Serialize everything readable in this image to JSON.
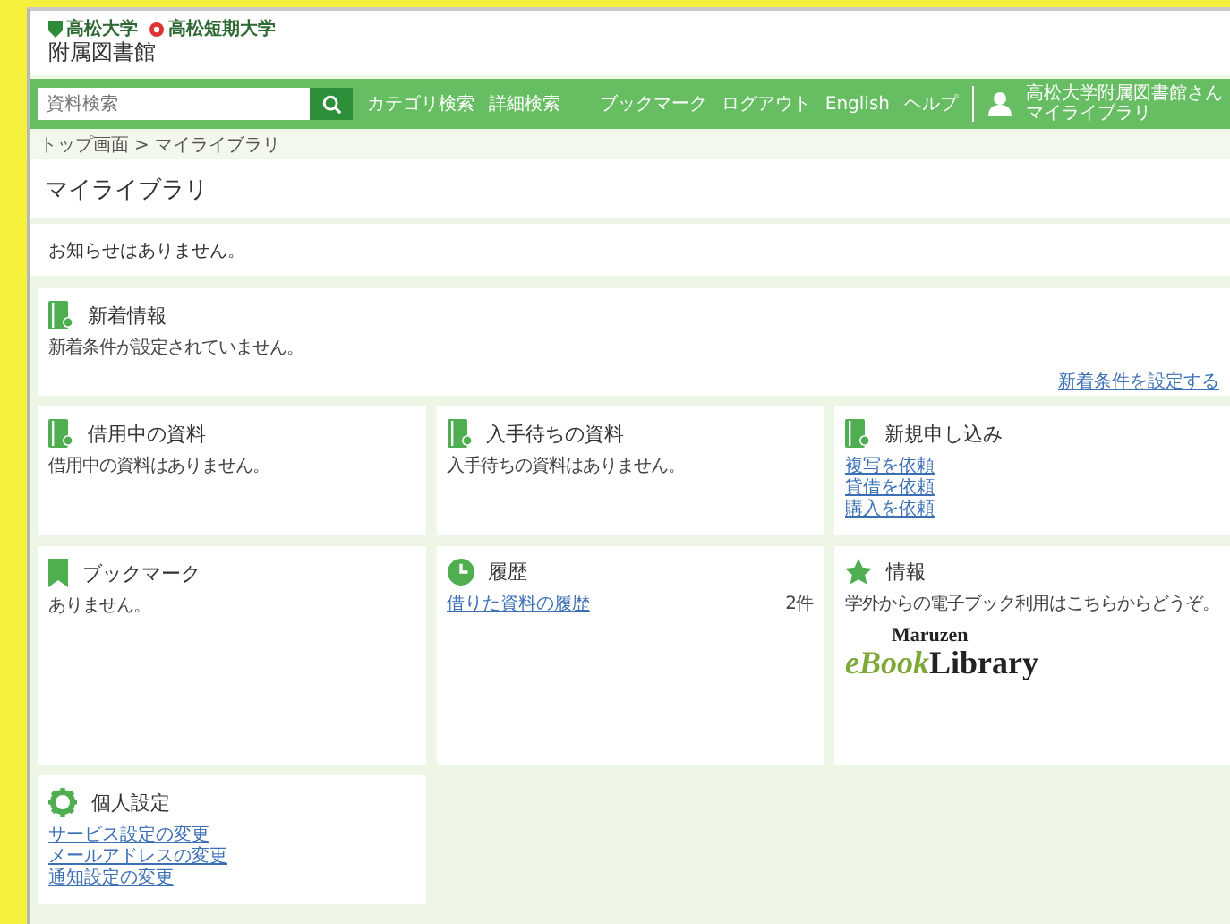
{
  "header": {
    "universities": [
      {
        "name": "高松大学"
      },
      {
        "name": "高松短期大学"
      }
    ],
    "title": "附属図書館"
  },
  "nav": {
    "search": {
      "placeholder": "資料検索"
    },
    "links": [
      "カテゴリ検索",
      "詳細検索"
    ],
    "right_links": [
      "ブックマーク",
      "ログアウト",
      "English",
      "ヘルプ"
    ],
    "user": {
      "name": "高松大学附属図書館さん",
      "link": "マイライブラリ"
    }
  },
  "breadcrumb": {
    "items": [
      "トップ画面",
      "マイライブラリ"
    ],
    "separator": ">"
  },
  "page_title": "マイライブラリ",
  "notice": "お知らせはありません。",
  "cards": [
    {
      "title": "新着情報",
      "kind": "book",
      "items": [
        {
          "kind": "text",
          "text": "新着条件が設定されていません。"
        }
      ],
      "footer_link": "新着条件を設定する"
    },
    {
      "title": "借用中の資料",
      "kind": "book",
      "items": [
        {
          "kind": "text",
          "text": "借用中の資料はありません。"
        }
      ]
    },
    {
      "title": "入手待ちの資料",
      "kind": "book",
      "items": [
        {
          "kind": "text",
          "text": "入手待ちの資料はありません。"
        }
      ]
    },
    {
      "title": "新規申し込み",
      "kind": "book",
      "items": [
        {
          "kind": "link",
          "text": "複写を依頼"
        },
        {
          "kind": "link",
          "text": "貸借を依頼"
        },
        {
          "kind": "link",
          "text": "購入を依頼"
        }
      ]
    },
    {
      "title": "ブックマーク",
      "kind": "bookmark",
      "items": [
        {
          "kind": "text",
          "text": "ありません。"
        }
      ]
    },
    {
      "title": "履歴",
      "kind": "clock",
      "items": [
        {
          "kind": "count_link",
          "text": "借りた資料の履歴",
          "count": "2件"
        }
      ]
    },
    {
      "title": "情報",
      "kind": "star",
      "items": [
        {
          "kind": "text",
          "text": "学外からの電子ブック利用はこちらからどうぞ。"
        },
        {
          "kind": "logo",
          "top": "Maruzen",
          "accent": "eBook",
          "rest": "Library"
        }
      ]
    },
    {
      "title": "個人設定",
      "kind": "gear",
      "items": [
        {
          "kind": "link",
          "text": "サービス設定の変更"
        },
        {
          "kind": "link",
          "text": "メールアドレスの変更"
        },
        {
          "kind": "link",
          "text": "通知設定の変更"
        }
      ]
    }
  ]
}
